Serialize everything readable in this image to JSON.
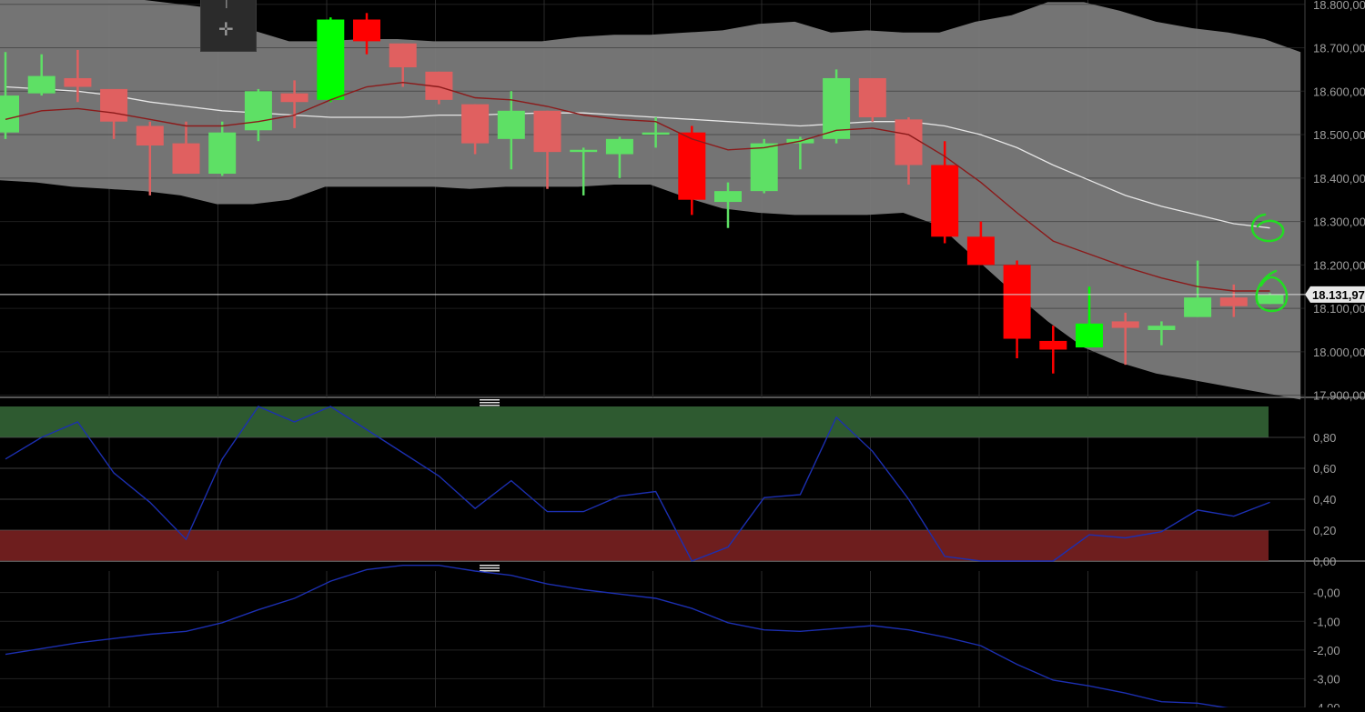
{
  "chart_data": [
    {
      "type": "candlestick",
      "title": "",
      "ylim": [
        17895,
        18810
      ],
      "y_ticks": [
        "18.800,00",
        "18.700,00",
        "18.600,00",
        "18.500,00",
        "18.400,00",
        "18.300,00",
        "18.200,00",
        "18.100,00",
        "18.000,00",
        "17.900,00"
      ],
      "current_price_label": "18.131,97",
      "current_price": 18131.97,
      "candles": [
        {
          "open": 18505,
          "high": 18690,
          "low": 18490,
          "close": 18590
        },
        {
          "open": 18595,
          "high": 18685,
          "low": 18590,
          "close": 18635
        },
        {
          "open": 18630,
          "high": 18695,
          "low": 18575,
          "close": 18610
        },
        {
          "open": 18605,
          "high": 18600,
          "low": 18490,
          "close": 18530
        },
        {
          "open": 18520,
          "high": 18530,
          "low": 18360,
          "close": 18475
        },
        {
          "open": 18480,
          "high": 18530,
          "low": 18410,
          "close": 18410
        },
        {
          "open": 18410,
          "high": 18530,
          "low": 18405,
          "close": 18505
        },
        {
          "open": 18510,
          "high": 18605,
          "low": 18485,
          "close": 18600
        },
        {
          "open": 18595,
          "high": 18625,
          "low": 18515,
          "close": 18575
        },
        {
          "open": 18580,
          "high": 18770,
          "low": 18575,
          "close": 18765
        },
        {
          "open": 18765,
          "high": 18780,
          "low": 18685,
          "close": 18715
        },
        {
          "open": 18710,
          "high": 18710,
          "low": 18610,
          "close": 18655
        },
        {
          "open": 18645,
          "high": 18645,
          "low": 18570,
          "close": 18580
        },
        {
          "open": 18570,
          "high": 18570,
          "low": 18455,
          "close": 18480
        },
        {
          "open": 18490,
          "high": 18600,
          "low": 18420,
          "close": 18555
        },
        {
          "open": 18555,
          "high": 18555,
          "low": 18375,
          "close": 18460
        },
        {
          "open": 18460,
          "high": 18470,
          "low": 18360,
          "close": 18465
        },
        {
          "open": 18455,
          "high": 18495,
          "low": 18400,
          "close": 18490
        },
        {
          "open": 18500,
          "high": 18540,
          "low": 18470,
          "close": 18505
        },
        {
          "open": 18505,
          "high": 18520,
          "low": 18315,
          "close": 18350
        },
        {
          "open": 18345,
          "high": 18390,
          "low": 18285,
          "close": 18370
        },
        {
          "open": 18370,
          "high": 18490,
          "low": 18365,
          "close": 18480
        },
        {
          "open": 18480,
          "high": 18495,
          "low": 18420,
          "close": 18490
        },
        {
          "open": 18490,
          "high": 18650,
          "low": 18480,
          "close": 18630
        },
        {
          "open": 18630,
          "high": 18630,
          "low": 18530,
          "close": 18540
        },
        {
          "open": 18535,
          "high": 18540,
          "low": 18385,
          "close": 18430
        },
        {
          "open": 18430,
          "high": 18485,
          "low": 18250,
          "close": 18265
        },
        {
          "open": 18265,
          "high": 18300,
          "low": 18200,
          "close": 18200
        },
        {
          "open": 18200,
          "high": 18210,
          "low": 17985,
          "close": 18030
        },
        {
          "open": 18025,
          "high": 18060,
          "low": 17950,
          "close": 18005
        },
        {
          "open": 18010,
          "high": 18150,
          "low": 18010,
          "close": 18065
        },
        {
          "open": 18070,
          "high": 18090,
          "low": 17970,
          "close": 18055
        },
        {
          "open": 18050,
          "high": 18070,
          "low": 18015,
          "close": 18060
        },
        {
          "open": 18080,
          "high": 18210,
          "low": 18080,
          "close": 18125
        },
        {
          "open": 18125,
          "high": 18155,
          "low": 18080,
          "close": 18105
        },
        {
          "open": 18110,
          "high": 18135,
          "low": 18110,
          "close": 18132
        }
      ],
      "overlays": {
        "bollinger_upper": [
          18830,
          18840,
          18830,
          18825,
          18810,
          18800,
          18790,
          18740,
          18715,
          18715,
          18720,
          18720,
          18715,
          18715,
          18715,
          18715,
          18725,
          18730,
          18730,
          18735,
          18740,
          18755,
          18760,
          18735,
          18740,
          18735,
          18735,
          18760,
          18775,
          18805,
          18805,
          18785,
          18760,
          18745,
          18735,
          18720,
          18690
        ],
        "bollinger_lower": [
          18395,
          18390,
          18380,
          18375,
          18370,
          18360,
          18340,
          18340,
          18350,
          18380,
          18380,
          18380,
          18380,
          18375,
          18380,
          18380,
          18380,
          18385,
          18385,
          18355,
          18330,
          18320,
          18315,
          18315,
          18315,
          18320,
          18290,
          18215,
          18140,
          18070,
          18010,
          17975,
          17950,
          17935,
          17920,
          17905,
          17890
        ],
        "moving_average_white": [
          18610,
          18605,
          18600,
          18590,
          18575,
          18565,
          18555,
          18550,
          18545,
          18540,
          18540,
          18540,
          18545,
          18545,
          18548,
          18550,
          18550,
          18545,
          18540,
          18535,
          18530,
          18525,
          18520,
          18525,
          18530,
          18530,
          18520,
          18500,
          18470,
          18430,
          18395,
          18360,
          18335,
          18315,
          18295,
          18285
        ],
        "moving_average_red": [
          18535,
          18555,
          18560,
          18550,
          18535,
          18520,
          18520,
          18530,
          18545,
          18580,
          18610,
          18620,
          18610,
          18585,
          18580,
          18565,
          18545,
          18535,
          18530,
          18490,
          18465,
          18470,
          18485,
          18510,
          18515,
          18500,
          18450,
          18390,
          18320,
          18255,
          18225,
          18195,
          18170,
          18150,
          18140,
          18140
        ]
      },
      "annotations": [
        "green-circle-at-white-ma-end",
        "green-circle-at-last-candle"
      ]
    },
    {
      "type": "line",
      "title": "",
      "ylim": [
        0,
        1.0
      ],
      "y_ticks": [
        "0,80",
        "0,60",
        "0,40",
        "0,20",
        "0,00"
      ],
      "overbought_band": [
        0.8,
        1.0
      ],
      "oversold_band": [
        0.0,
        0.2
      ],
      "band_colors": {
        "overbought": "#2e5a30",
        "oversold": "#6e1e1e"
      },
      "series": [
        {
          "values": [
            0.66,
            0.8,
            0.9,
            0.57,
            0.38,
            0.14,
            0.66,
            1.0,
            0.9,
            1.0,
            0.85,
            0.7,
            0.55,
            0.34,
            0.52,
            0.32,
            0.32,
            0.42,
            0.45,
            0.0,
            0.09,
            0.41,
            0.43,
            0.93,
            0.71,
            0.4,
            0.03,
            0.0,
            0.0,
            0.0,
            0.17,
            0.15,
            0.19,
            0.33,
            0.29,
            0.38
          ]
        }
      ]
    },
    {
      "type": "line",
      "title": "",
      "ylim": [
        -4.0,
        0.75
      ],
      "y_ticks": [
        "-0,00",
        "-1,00",
        "-2,00",
        "-3,00",
        "-4,00"
      ],
      "series": [
        {
          "values": [
            -2.15,
            -1.95,
            -1.75,
            -1.6,
            -1.45,
            -1.35,
            -1.05,
            -0.6,
            -0.2,
            0.4,
            0.8,
            0.95,
            0.95,
            0.75,
            0.6,
            0.3,
            0.1,
            -0.05,
            -0.2,
            -0.55,
            -1.05,
            -1.3,
            -1.35,
            -1.25,
            -1.15,
            -1.3,
            -1.55,
            -1.85,
            -2.5,
            -3.05,
            -3.25,
            -3.5,
            -3.8,
            -3.85,
            -4.05,
            -4.1
          ]
        }
      ]
    }
  ],
  "colors": {
    "bull": "#5ee065",
    "bull_bright": "#00ff00",
    "bear": "#e06060",
    "bear_bright": "#ff0000",
    "band_fill": "#7a7a7a",
    "ma_white": "#e6e6e6",
    "ma_red": "#8b1a1a",
    "indicator_line": "#1c2fb0",
    "grid": "#2a2a2a",
    "axis_text": "#9e9e9e",
    "annotation": "#22dd22"
  },
  "toolbar_icons": [
    "cursor-icon",
    "crosshair-icon"
  ]
}
